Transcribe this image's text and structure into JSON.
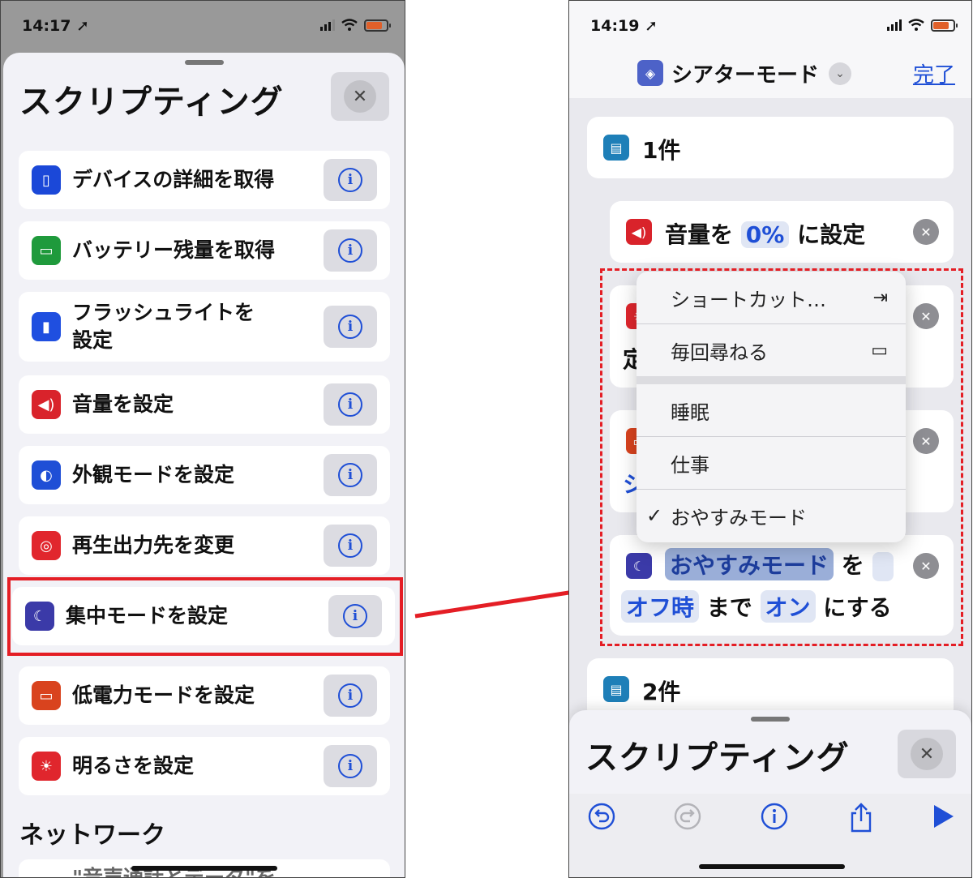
{
  "left": {
    "status_time": "14:17 ➚",
    "sheet_title": "スクリプティング",
    "actions": [
      {
        "label": "デバイスの詳細を取得",
        "color": "#1b48d8",
        "icon": "phone-icon",
        "glyph": "▯"
      },
      {
        "label": "バッテリー残量を取得",
        "color": "#1f9a3c",
        "icon": "battery-icon",
        "glyph": "▭"
      },
      {
        "label": "フラッシュライトを\n設定",
        "color": "#1f4fe0",
        "icon": "flashlight-icon",
        "glyph": "▮"
      },
      {
        "label": "音量を設定",
        "color": "#d9232b",
        "icon": "speaker-icon",
        "glyph": "◀)"
      },
      {
        "label": "外観モードを設定",
        "color": "#1f4fd6",
        "icon": "appearance-icon",
        "glyph": "◐"
      },
      {
        "label": "再生出力先を変更",
        "color": "#e1262d",
        "icon": "airplay-icon",
        "glyph": "◎"
      },
      {
        "label": "集中モードを設定",
        "color": "#3b3aa8",
        "icon": "moon-icon",
        "glyph": "☾"
      },
      {
        "label": "低電力モードを設定",
        "color": "#d9431e",
        "icon": "low-power-icon",
        "glyph": "▭"
      },
      {
        "label": "明るさを設定",
        "color": "#e0262d",
        "icon": "brightness-icon",
        "glyph": "☀"
      }
    ],
    "section_title": "ネットワーク",
    "next_row_partial": "\"音声通話とデータ\"を"
  },
  "right": {
    "status_time": "14:19 ➚",
    "nav_title": "シアターモード",
    "done_label": "完了",
    "card1_text": "1件",
    "volume_prefix": "音量を",
    "volume_value": "0%",
    "volume_suffix": "に設定",
    "hidden_partial_1": "定",
    "hidden_partial_2": "シ",
    "focus_mode_token": "おやすみモード",
    "focus_particle": "を",
    "focus_until_token": "オフ時",
    "focus_until_text": "まで",
    "focus_state_token": "オン",
    "focus_state_suffix": "にする",
    "card2_text": "2件",
    "menu": {
      "shortcut": "ショートカット…",
      "ask": "毎回尋ねる",
      "sleep": "睡眠",
      "work": "仕事",
      "dnd": "おやすみモード",
      "check": "✓"
    },
    "sheet_title": "スクリプティング"
  }
}
